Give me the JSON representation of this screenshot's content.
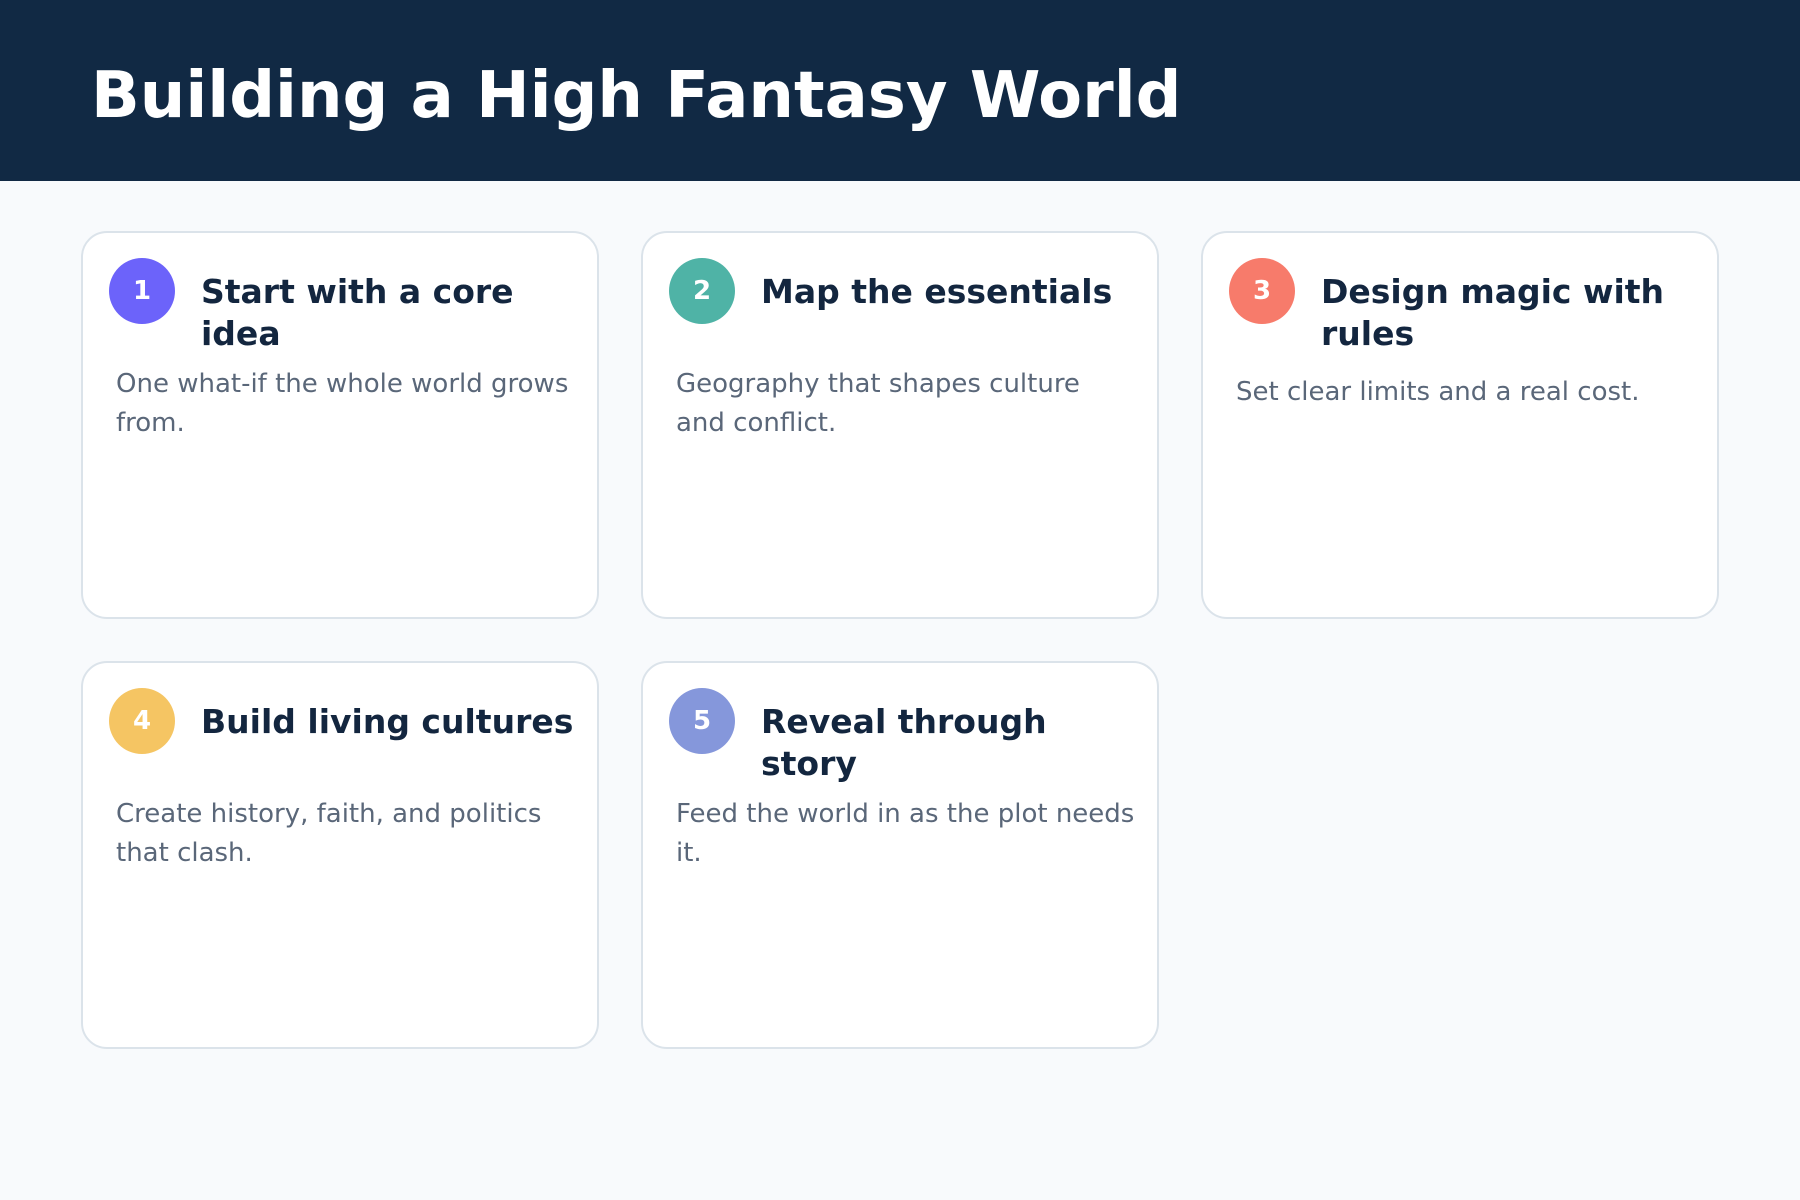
{
  "page": {
    "title": "Building a High Fantasy World"
  },
  "colors": {
    "header_bg": "#112944",
    "page_bg": "#f8fafc",
    "card_bg": "#ffffff",
    "card_border": "#dbe3ea",
    "title_text": "#13263f",
    "desc_text": "#5a6779"
  },
  "cards": [
    {
      "number": "1",
      "title": "Start with a core idea",
      "description": "One what-if the whole world grows from.",
      "badge_color": "#6c63fa"
    },
    {
      "number": "2",
      "title": "Map the essentials",
      "description": "Geography that shapes culture and conflict.",
      "badge_color": "#4fb3a6"
    },
    {
      "number": "3",
      "title": "Design magic with rules",
      "description": "Set clear limits and a real cost.",
      "badge_color": "#f77b6b"
    },
    {
      "number": "4",
      "title": "Build living cultures",
      "description": "Create history, faith, and politics that clash.",
      "badge_color": "#f5c563"
    },
    {
      "number": "5",
      "title": "Reveal through story",
      "description": "Feed the world in as the plot needs it.",
      "badge_color": "#8597db"
    }
  ]
}
